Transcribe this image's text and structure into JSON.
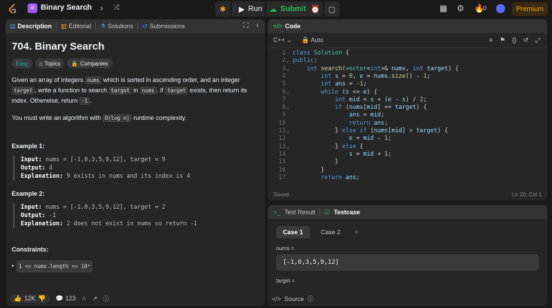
{
  "topbar": {
    "problem_title": "Binary Search",
    "run_label": "Run",
    "submit_label": "Submit",
    "streak_count": "0",
    "premium_label": "Premium"
  },
  "left_tabs": {
    "description": "Description",
    "editorial": "Editorial",
    "solutions": "Solutions",
    "submissions": "Submissions"
  },
  "problem": {
    "title": "704. Binary Search",
    "difficulty": "Easy",
    "topics": "Topics",
    "companies": "Companies",
    "p1_a": "Given an array of integers ",
    "p1_code1": "nums",
    "p1_b": " which is sorted in ascending order, and an integer ",
    "p1_code2": "target",
    "p1_c": ", write a function to search ",
    "p1_code3": "target",
    "p1_d": " in ",
    "p1_code4": "nums",
    "p1_e": ". If ",
    "p1_code5": "target",
    "p1_f": " exists, then return its index. Otherwise, return ",
    "p1_code6": "-1",
    "p1_g": ".",
    "p2_a": "You must write an algorithm with ",
    "p2_code": "O(log n)",
    "p2_b": " runtime complexity.",
    "ex1_title": "Example 1:",
    "ex1_input_label": "Input:",
    "ex1_input": "nums = [-1,0,3,5,9,12], target = 9",
    "ex1_output_label": "Output:",
    "ex1_output": "4",
    "ex1_expl_label": "Explanation:",
    "ex1_expl": "9 exists in nums and its index is 4",
    "ex2_title": "Example 2:",
    "ex2_input_label": "Input:",
    "ex2_input": "nums = [-1,0,3,5,9,12], target = 2",
    "ex2_output_label": "Output:",
    "ex2_output": "-1",
    "ex2_expl_label": "Explanation:",
    "ex2_expl": "2 does not exist in nums so return -1",
    "constraints_title": "Constraints:",
    "constraint1": "1 <= nums.length <= 10⁴"
  },
  "bottom": {
    "likes": "12K",
    "comments": "123"
  },
  "code": {
    "tab_label": "Code",
    "language": "C++",
    "auto_label": "Auto",
    "status": "Saved",
    "cursor": "Ln 20, Col 1",
    "line_numbers": [
      "1",
      "2",
      "3",
      "4",
      "5",
      "6",
      "7",
      "8",
      "9",
      "10",
      "11",
      "12",
      "13",
      "14",
      "15",
      "16",
      "17"
    ]
  },
  "test": {
    "result_tab": "Test Result",
    "testcase_tab": "Testcase",
    "case1": "Case 1",
    "case2": "Case 2",
    "add": "+",
    "nums_label": "nums =",
    "nums_value": "[-1,0,3,5,9,12]",
    "target_label": "target =",
    "source_label": "Source"
  }
}
